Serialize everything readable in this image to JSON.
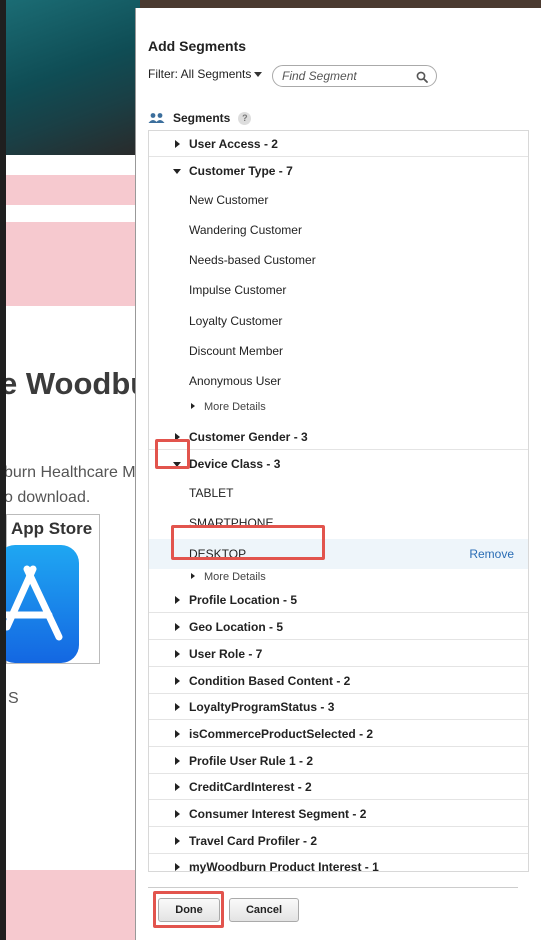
{
  "background": {
    "title_fragment": "e Woodbu",
    "line1": "burn Healthcare M",
    "line2": "o download.",
    "appstore_label": "App Store",
    "s_fragment": "S"
  },
  "dialog": {
    "title": "Add Segments",
    "filter_label": "Filter: All Segments",
    "search_placeholder": "Find Segment",
    "segments_label": "Segments",
    "help_glyph": "?"
  },
  "groups": {
    "user_access": "User Access - 2",
    "customer_type": "Customer Type - 7",
    "customer_gender": "Customer Gender - 3",
    "device_class": "Device Class - 3",
    "profile_location": "Profile Location - 5",
    "geo_location": "Geo Location - 5",
    "user_role": "User Role - 7",
    "condition_based": "Condition Based Content - 2",
    "loyalty_status": "LoyaltyProgramStatus - 3",
    "is_commerce": "isCommerceProductSelected - 2",
    "profile_user_rule": "Profile User Rule 1 - 2",
    "credit_card": "CreditCardInterest - 2",
    "consumer_interest": "Consumer Interest Segment - 2",
    "travel_card": "Travel Card Profiler - 2",
    "mywoodburn": "myWoodburn Product Interest - 1"
  },
  "customer_type_items": [
    "New Customer",
    "Wandering Customer",
    "Needs-based Customer",
    "Impulse Customer",
    "Loyalty Customer",
    "Discount Member",
    "Anonymous User"
  ],
  "device_class_items": [
    "TABLET",
    "SMARTPHONE",
    "DESKTOP"
  ],
  "more_details": "More Details",
  "remove_label": "Remove",
  "buttons": {
    "done": "Done",
    "cancel": "Cancel"
  },
  "colors": {
    "highlight_box": "#e2544d",
    "link": "#2a6db5",
    "selected_row": "#eef5fa"
  }
}
